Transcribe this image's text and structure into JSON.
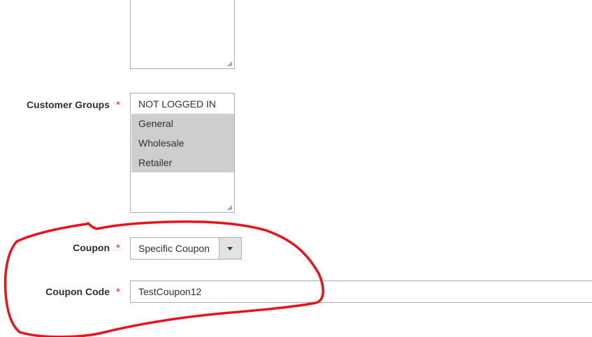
{
  "form": {
    "customer_groups": {
      "label": "Customer Groups",
      "required_mark": "*",
      "options": [
        {
          "label": "NOT LOGGED IN",
          "selected": false
        },
        {
          "label": "General",
          "selected": true
        },
        {
          "label": "Wholesale",
          "selected": true
        },
        {
          "label": "Retailer",
          "selected": true
        }
      ]
    },
    "coupon": {
      "label": "Coupon",
      "required_mark": "*",
      "selected_value": "Specific Coupon"
    },
    "coupon_code": {
      "label": "Coupon Code",
      "required_mark": "*",
      "value": "TestCoupon12"
    }
  },
  "annotation": {
    "type": "hand-drawn-circle",
    "color": "#e8141c",
    "encloses": [
      "coupon",
      "coupon_code"
    ]
  },
  "colors": {
    "required_star": "#e22626",
    "selected_option_bg": "#cecece",
    "border": "#adadad",
    "label_text": "#303030"
  },
  "icons": {
    "select_arrow": "chevron-down-icon",
    "resize_grip": "resize-grip-icon"
  }
}
